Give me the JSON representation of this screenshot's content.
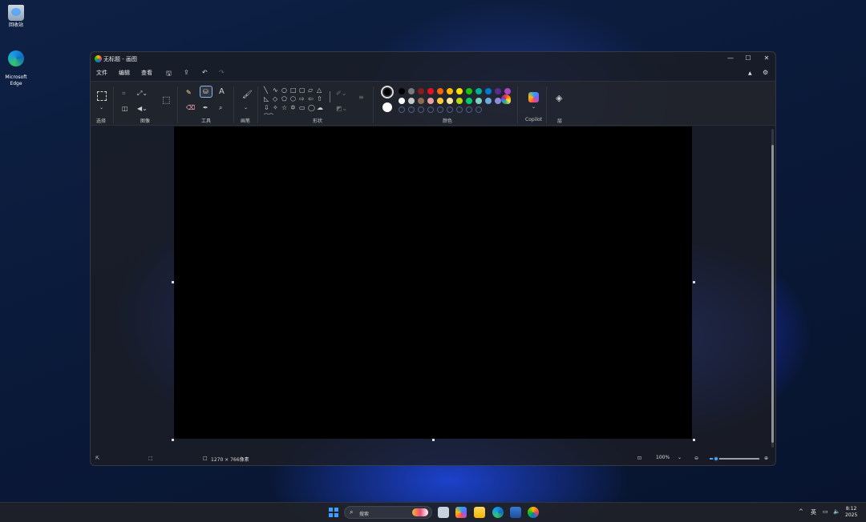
{
  "desktop": {
    "icons": [
      {
        "label": "回收站"
      },
      {
        "label": "Microsoft\nEdge"
      }
    ]
  },
  "window": {
    "title": "无标题 - 画图",
    "controls": {
      "minimize": "—",
      "maximize": "☐",
      "close": "✕"
    }
  },
  "menu": {
    "file": "文件",
    "edit": "编辑",
    "view": "查看"
  },
  "ribbon": {
    "groups": {
      "selection": "选择",
      "image": "图像",
      "tools": "工具",
      "brushes": "画笔",
      "shapes": "形状",
      "colors": "颜色",
      "copilot": "Copilot",
      "layers": "层"
    },
    "palette_row1": [
      "#000000",
      "#7a7a7a",
      "#8b1a1a",
      "#e81123",
      "#f7630c",
      "#ffb900",
      "#fce100",
      "#16c60c",
      "#00b294",
      "#0078d4",
      "#5c2d91",
      "#b146c2"
    ],
    "palette_row2": [
      "#ffffff",
      "#c8c8c8",
      "#8e6b4e",
      "#e8a0a0",
      "#ffc83d",
      "#f9e79f",
      "#bad80a",
      "#00cc6a",
      "#7fd1c8",
      "#6fa8dc",
      "#8e8cd8",
      "#e3a8f0"
    ],
    "primary_color": "#000000",
    "secondary_color": "#ffffff"
  },
  "status": {
    "dimensions": "1270 × 766像素",
    "zoom": "100%"
  },
  "taskbar": {
    "search_placeholder": "搜索",
    "ime": "英",
    "time": "8:12",
    "date": "2025"
  }
}
